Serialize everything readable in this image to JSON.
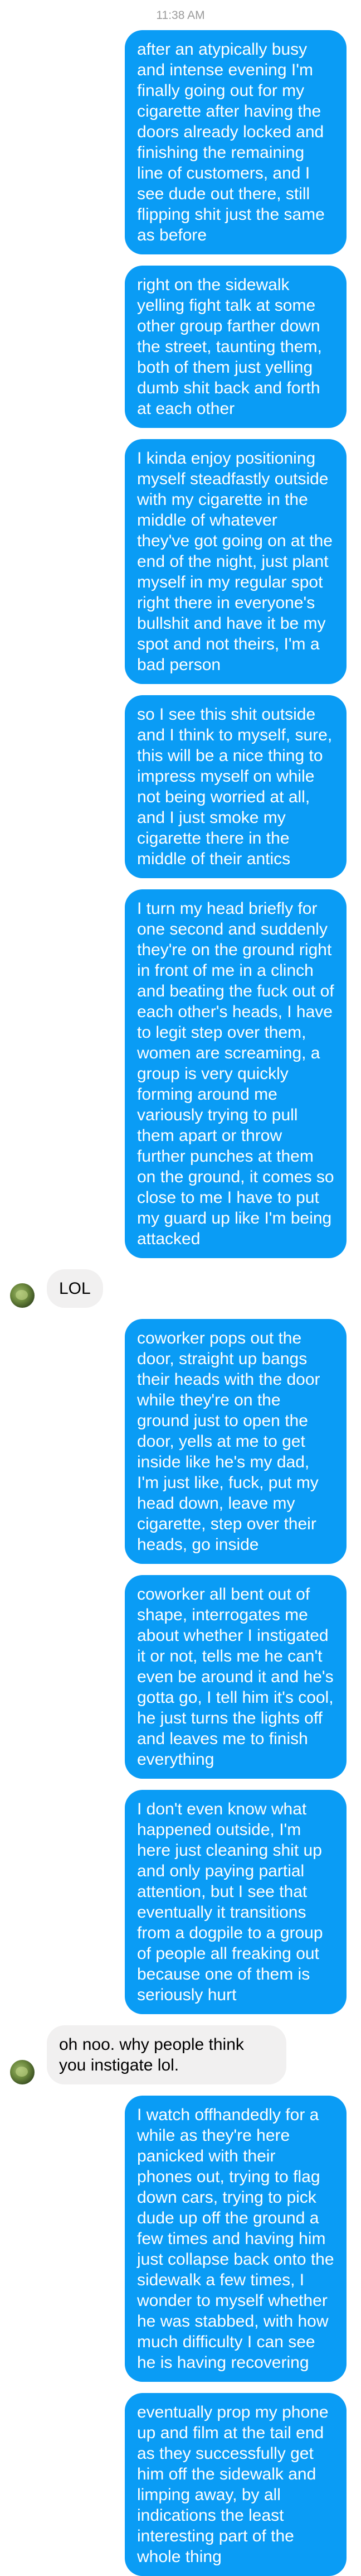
{
  "header": {
    "timestamp": "11:38 AM"
  },
  "colors": {
    "outgoing_bubble": "#0a9cf5",
    "incoming_bubble": "#f1f0f0",
    "timestamp_text": "#9b9b9b"
  },
  "messages": [
    {
      "direction": "out",
      "text": "after an atypically busy and intense evening I'm finally going out for my cigarette after having the doors already locked and finishing the remaining line of customers, and I see dude out there, still flipping shit just the same as before"
    },
    {
      "direction": "out",
      "text": "right on the sidewalk yelling fight talk at some other group farther down the street, taunting them, both of them just yelling dumb shit back and forth at each other"
    },
    {
      "direction": "out",
      "text": "I kinda enjoy positioning myself steadfastly outside with my cigarette in the middle of whatever they've got going on at the end of the night, just plant myself in my regular spot right there in everyone's bullshit and have it be my spot and not theirs, I'm a bad person"
    },
    {
      "direction": "out",
      "text": "so I see this shit outside and I think to myself, sure, this will be a nice thing to impress myself on while not being worried at all, and I just smoke my cigarette there in the middle of their antics"
    },
    {
      "direction": "out",
      "text": "I turn my head briefly for one second and suddenly they're on the ground right in front of me in a clinch and beating the fuck out of each other's heads, I have to legit step over them, women are screaming, a group is very quickly forming around me variously trying to pull them apart or throw further punches at them on the ground, it comes so close to me I have to put my guard up like I'm being attacked"
    },
    {
      "direction": "in",
      "text": "LOL"
    },
    {
      "direction": "out",
      "text": "coworker pops out the door, straight up bangs their heads with the door while they're on the ground just to open the door, yells at me to get inside like he's my dad, I'm just like, fuck, put my head down, leave my cigarette, step over their heads, go inside"
    },
    {
      "direction": "out",
      "text": "coworker all bent out of shape, interrogates me about whether I instigated it or not, tells me he can't even be around it and he's gotta go, I tell him it's cool, he just turns the lights off and leaves me to finish everything"
    },
    {
      "direction": "out",
      "text": "I don't even know what happened outside, I'm here just cleaning shit up and only paying partial attention, but I see that eventually it transitions from a dogpile to a group of people all freaking out because one of them is seriously hurt"
    },
    {
      "direction": "in",
      "text": "oh noo. why people think you instigate lol."
    },
    {
      "direction": "out",
      "text": "I watch offhandedly for a while as they're here panicked with their phones out, trying to flag down cars, trying to pick dude up off the ground a few times and having him just collapse back onto the sidewalk a few times, I wonder to myself whether he was stabbed, with how much difficulty I can see he is having recovering"
    },
    {
      "direction": "out",
      "text": "eventually prop my phone up and film at the tail end as they successfully get him off the sidewalk and limping away, by all indications the least interesting part of the whole thing"
    }
  ]
}
